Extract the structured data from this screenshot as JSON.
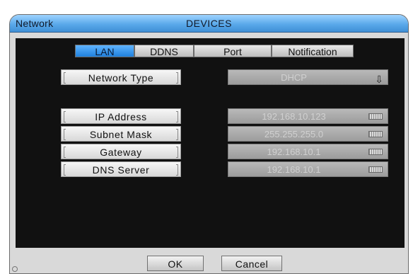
{
  "window": {
    "title_left": "Network",
    "title_center": "DEVICES"
  },
  "tabs": [
    {
      "label": "LAN",
      "active": true
    },
    {
      "label": "DDNS",
      "active": false
    },
    {
      "label": "Port",
      "active": false
    },
    {
      "label": "Notification",
      "active": false
    }
  ],
  "network_type": {
    "label": "Network Type",
    "value": "DHCP",
    "icon": "dropdown-arrow-icon"
  },
  "fields": [
    {
      "label": "IP Address",
      "value": "192.168.10.123",
      "icon": "keyboard-icon"
    },
    {
      "label": "Subnet Mask",
      "value": "255.255.255.0",
      "icon": "keyboard-icon"
    },
    {
      "label": "Gateway",
      "value": "192.168.10.1",
      "icon": "keyboard-icon"
    },
    {
      "label": "DNS Server",
      "value": "192.168.10.1",
      "icon": "keyboard-icon"
    }
  ],
  "buttons": {
    "ok": "OK",
    "cancel": "Cancel"
  },
  "colors": {
    "title_bar": "#5aa9ea",
    "active_tab": "#1f80dd",
    "panel_bg": "#111111"
  }
}
